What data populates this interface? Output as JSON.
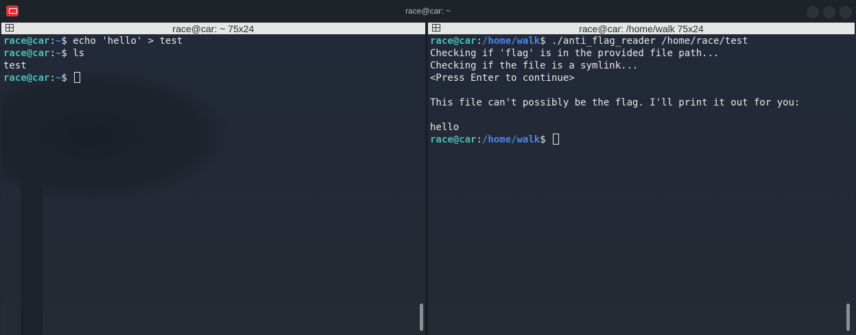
{
  "window": {
    "title": "race@car: ~"
  },
  "left_pane": {
    "title": "race@car: ~ 75x24",
    "lines": [
      {
        "user": "race",
        "host": "car",
        "path": "~",
        "cmd": " echo 'hello' > test"
      },
      {
        "user": "race",
        "host": "car",
        "path": "~",
        "cmd": " ls"
      },
      {
        "output": "test"
      },
      {
        "user": "race",
        "host": "car",
        "path": "~",
        "cmd": " ",
        "cursor": true
      }
    ]
  },
  "right_pane": {
    "title": "race@car: /home/walk 75x24",
    "lines": [
      {
        "user": "race",
        "host": "car",
        "path": "/home/walk",
        "cmd": " ./anti_flag_reader /home/race/test"
      },
      {
        "output": "Checking if 'flag' is in the provided file path..."
      },
      {
        "output": "Checking if the file is a symlink..."
      },
      {
        "output": "<Press Enter to continue>"
      },
      {
        "output": ""
      },
      {
        "output": "This file can't possibly be the flag. I'll print it out for you:"
      },
      {
        "output": ""
      },
      {
        "output": "hello"
      },
      {
        "user": "race",
        "host": "car",
        "path": "/home/walk",
        "cmd": " ",
        "cursor": true
      }
    ]
  },
  "colors": {
    "prompt_user": "#48bdb4",
    "prompt_path": "#4a86e8",
    "text": "#e8e8e8",
    "background": "#222936"
  },
  "icons": [
    "app-icon",
    "split-pane-icon",
    "window-control-icon"
  ]
}
